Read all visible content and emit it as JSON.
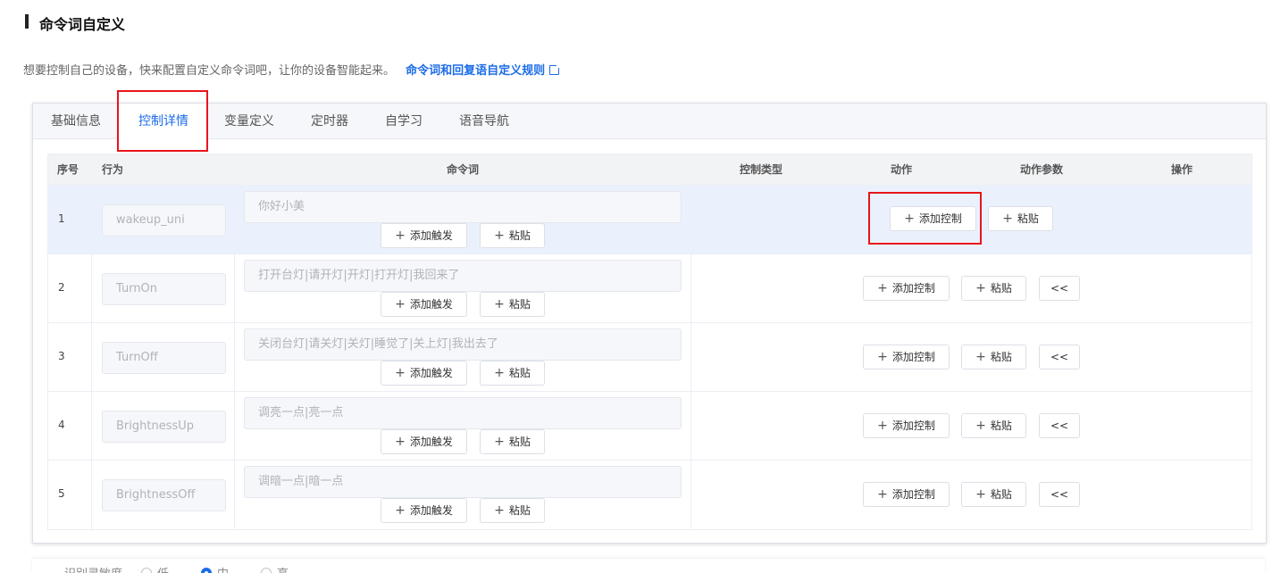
{
  "page": {
    "title": "命令词自定义",
    "description": "想要控制自己的设备，快来配置自定义命令词吧，让你的设备智能起来。",
    "rules_link": "命令词和回复语自定义规则"
  },
  "tabs": [
    "基础信息",
    "控制详情",
    "变量定义",
    "定时器",
    "自学习",
    "语音导航"
  ],
  "table": {
    "headers": {
      "index": "序号",
      "behavior": "行为",
      "command": "命令词",
      "control_type": "控制类型",
      "action": "动作",
      "action_params": "动作参数",
      "operation": "操作"
    },
    "rows": [
      {
        "index": "1",
        "behavior": "wakeup_uni",
        "command": "你好小美"
      },
      {
        "index": "2",
        "behavior": "TurnOn",
        "command": "打开台灯|请开灯|开灯|打开灯|我回来了"
      },
      {
        "index": "3",
        "behavior": "TurnOff",
        "command": "关闭台灯|请关灯|关灯|睡觉了|关上灯|我出去了"
      },
      {
        "index": "4",
        "behavior": "BrightnessUp",
        "command": "调亮一点|亮一点"
      },
      {
        "index": "5",
        "behavior": "BrightnessOff",
        "command": "调暗一点|暗一点"
      }
    ],
    "buttons": {
      "add_trigger": "添加触发",
      "paste": "粘贴",
      "add_control": "添加控制",
      "collapse": "<<"
    },
    "plus": "+"
  },
  "radio": {
    "label": "识别灵敏度",
    "options": [
      "低",
      "中",
      "高"
    ],
    "selected": "中"
  },
  "colors": {
    "accent": "#1c6ce8",
    "highlight": "#e8141a"
  }
}
